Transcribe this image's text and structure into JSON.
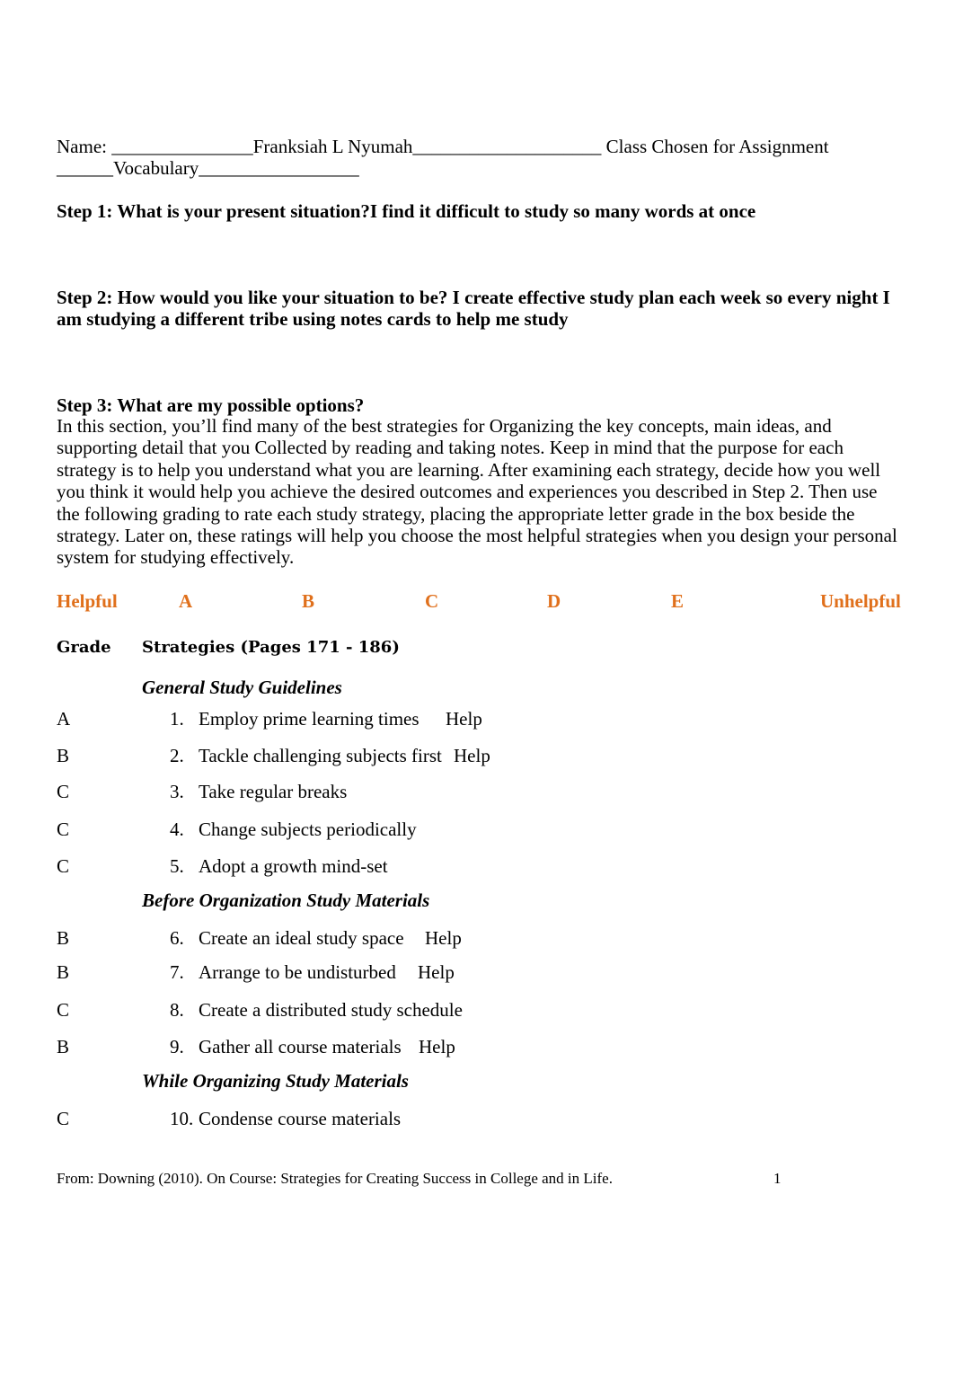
{
  "header": {
    "name_line": "Name: _______________Franksiah L Nyumah____________________ Class Chosen for Assignment",
    "class_line": "______Vocabulary_________________"
  },
  "step1": "Step 1: What is your present situation?I find it difficult to study so many words at once",
  "step2": {
    "line1": "Step 2: How would you like your situation to be? I create effective study plan each week so every night I",
    "line2": "am studying a different tribe using notes cards to help me study"
  },
  "step3": {
    "title": "Step 3: What are my possible options?",
    "lines": [
      "In this section, you’ll find many of the best strategies for Organizing the key concepts, main ideas, and",
      "supporting detail that you Collected by reading and taking notes. Keep in mind that the purpose for each",
      "strategy is to help you understand what you are learning. After examining each strategy, decide how you well",
      "you think it would help you achieve the desired outcomes and experiences you described in Step 2.  Then use",
      "the following grading to rate each study strategy, placing the appropriate letter grade in the box beside the",
      "strategy. Later on, these ratings will help you choose the most helpful strategies when you design your personal",
      "system for studying effectively."
    ]
  },
  "scale": {
    "helpful": "Helpful",
    "grades": [
      "A",
      "B",
      "C",
      "D",
      "E"
    ],
    "unhelpful": "Unhelpful"
  },
  "table": {
    "grade_header": "Grade",
    "strategies_header": "Strategies (Pages 171 - 186)",
    "sections": [
      "General Study Guidelines",
      "Before Organization Study Materials",
      "While Organizing Study Materials"
    ],
    "rows": [
      {
        "grade": "A",
        "num": "1.",
        "text": "Employ prime learning times",
        "note": "Help"
      },
      {
        "grade": "B",
        "num": "2.",
        "text": "Tackle challenging subjects first",
        "note": "Help"
      },
      {
        "grade": "C",
        "num": "3.",
        "text": "Take regular breaks",
        "note": ""
      },
      {
        "grade": "C",
        "num": "4.",
        "text": "Change subjects periodically",
        "note": ""
      },
      {
        "grade": "C",
        "num": "5.",
        "text": "Adopt a growth mind-set",
        "note": ""
      },
      {
        "grade": "B",
        "num": "6.",
        "text": "Create an ideal study space",
        "note": "Help"
      },
      {
        "grade": "B",
        "num": "7.",
        "text": "Arrange to be undisturbed",
        "note": "Help"
      },
      {
        "grade": "C",
        "num": "8.",
        "text": "Create a distributed study schedule",
        "note": ""
      },
      {
        "grade": "B",
        "num": "9.",
        "text": "Gather all course materials",
        "note": "Help"
      },
      {
        "grade": "C",
        "num": "10.",
        "text": "Condense course materials",
        "note": ""
      }
    ]
  },
  "footer": {
    "citation": "From: Downing (2010). On Course: Strategies for Creating Success in College and in Life.",
    "page_number": "1"
  }
}
